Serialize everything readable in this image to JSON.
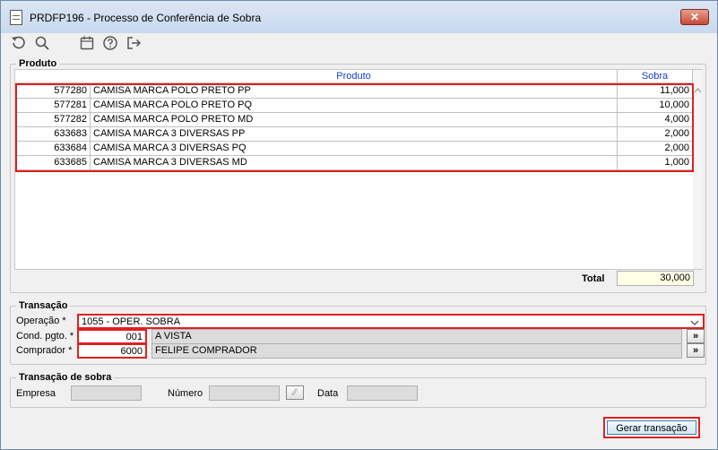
{
  "window": {
    "title": "PRDFP196 - Processo de Conferência de Sobra",
    "close_label": "✕"
  },
  "toolbar": {
    "icons": [
      "undo-icon",
      "search-icon",
      "calendar-icon",
      "help-icon",
      "exit-icon"
    ]
  },
  "produto": {
    "group_label": "Produto",
    "columns": [
      "Produto",
      "Sobra"
    ],
    "rows": [
      {
        "code": "577280",
        "description": "CAMISA MARCA POLO PRETO PP",
        "sobra": "11,000"
      },
      {
        "code": "577281",
        "description": "CAMISA MARCA POLO PRETO PQ",
        "sobra": "10,000"
      },
      {
        "code": "577282",
        "description": "CAMISA MARCA POLO PRETO MD",
        "sobra": "4,000"
      },
      {
        "code": "633683",
        "description": "CAMISA MARCA 3 DIVERSAS PP",
        "sobra": "2,000"
      },
      {
        "code": "633684",
        "description": "CAMISA MARCA 3 DIVERSAS PQ",
        "sobra": "2,000"
      },
      {
        "code": "633685",
        "description": "CAMISA MARCA 3 DIVERSAS MD",
        "sobra": "1,000"
      }
    ],
    "total_label": "Total",
    "total_value": "30,000"
  },
  "transacao": {
    "group_label": "Transação",
    "operacao_label": "Operação *",
    "operacao_value": "1055 - OPER. SOBRA",
    "cond_label": "Cond. pgto. *",
    "cond_code": "001",
    "cond_desc": "A VISTA",
    "comprador_label": "Comprador *",
    "comprador_code": "6000",
    "comprador_desc": "FELIPE COMPRADOR",
    "lookup_label": "»"
  },
  "transacao_sobra": {
    "group_label": "Transação de sobra",
    "empresa_label": "Empresa",
    "numero_label": "Número",
    "data_label": "Data"
  },
  "actions": {
    "gerar_label": "Gerar transação"
  }
}
